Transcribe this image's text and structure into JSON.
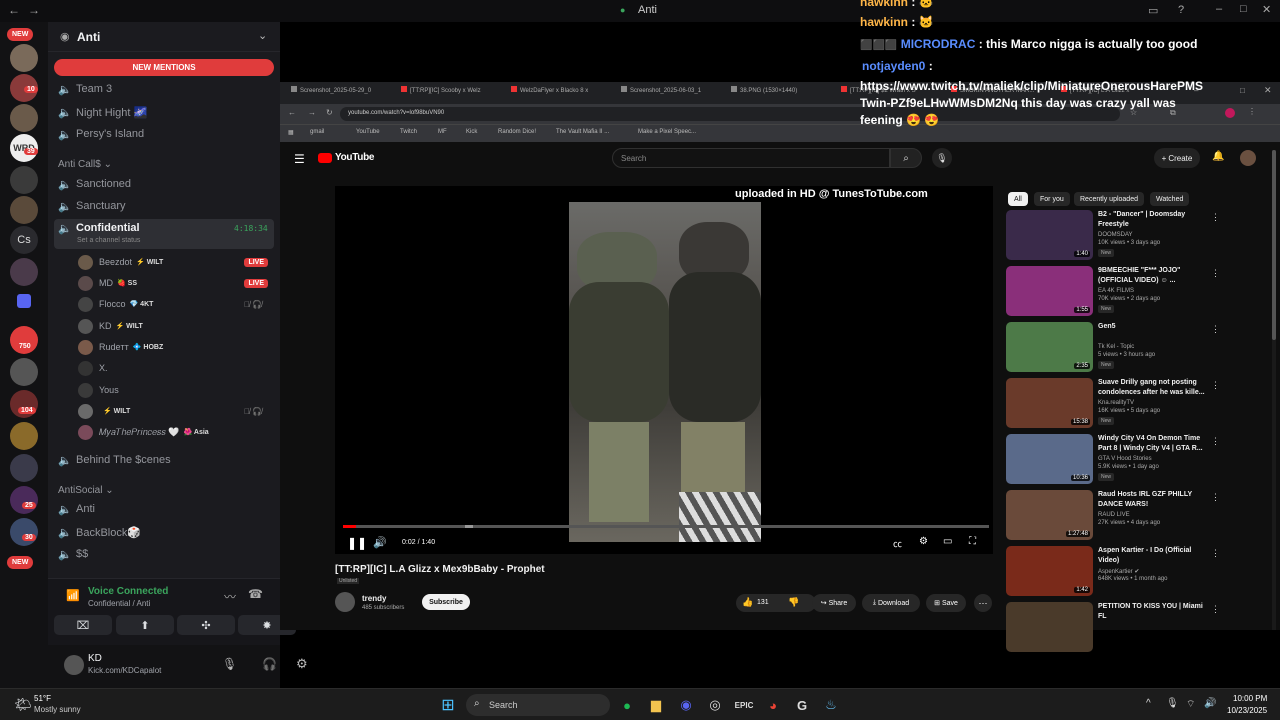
{
  "window": {
    "title": "Anti"
  },
  "rail": {
    "new_top": "NEW",
    "badges": [
      "10",
      "39",
      "750",
      "104",
      "25",
      "30"
    ],
    "new_bottom": "NEW",
    "cs_label": "Cs"
  },
  "server": {
    "name": "Anti",
    "mentions": "NEW MENTIONS"
  },
  "channels_top": [
    "Team 3",
    "Night Hight 🌌",
    "Persy's Island"
  ],
  "category_call": "Anti Call$",
  "channels_mid": [
    "Sanctioned",
    "Sanctuary"
  ],
  "active_channel": {
    "name": "Confidential",
    "timer": "4:18:34",
    "status": "Set a channel status"
  },
  "voice_users": [
    {
      "name": "Beezdot",
      "tag": "⚡ WILT",
      "live": "LIVE"
    },
    {
      "name": "MD",
      "tag": "🍓 SS",
      "live": "LIVE"
    },
    {
      "name": "Flocco",
      "tag": "💎 4KT",
      "live": ""
    },
    {
      "name": "KD",
      "tag": "⚡ WILT",
      "live": ""
    },
    {
      "name": "Rudeтт",
      "tag": "💠 HOBZ",
      "live": ""
    },
    {
      "name": "X.",
      "tag": "",
      "live": ""
    },
    {
      "name": "Yous",
      "tag": "",
      "live": ""
    },
    {
      "name": "",
      "tag": "⚡ WILT",
      "live": ""
    },
    {
      "name": "𝑀𝑦𝑎𝑇ℎ𝑒𝑃𝑟𝑖𝑛𝑐𝑒𝑠𝑠 🤍",
      "tag": "🌺 Asia",
      "live": ""
    }
  ],
  "channel_behind": "Behind The $cenes",
  "category_social": "AntiSocial",
  "channels_social": [
    "Anti",
    "BackBlock🎲",
    "$$"
  ],
  "voice": {
    "status": "Voice Connected",
    "location": "Confidential / Anti"
  },
  "account": {
    "name": "KD",
    "status": "Kick.com/KDCapalot"
  },
  "chat": [
    {
      "user": "hawkinn",
      "msg": ": 🐱"
    },
    {
      "user": "hawkinn",
      "msg": ": 🐱"
    },
    {
      "user": "MICRODRAC",
      "msg": ": this Marco nigga is actually too good"
    },
    {
      "user": "notjayden0",
      "msg": ":"
    },
    {
      "user": "",
      "msg": "https://www.twitch.tv/maliek/clip/MiniatureOnerousHarePMS"
    },
    {
      "user": "",
      "msg": "Twin-PZf9eLHwWMsDM2Nq this day was crazy yall was"
    },
    {
      "user": "",
      "msg": "feening 😍 😍"
    }
  ],
  "browser": {
    "tabs": [
      "Screenshot_2025-05-29_0",
      "[TT:RP][IC] Scooby x Welz",
      "WelzDaFlyer x Blacko 8 x",
      "Screenshot_2025-06-03_1",
      "38.PNG (1530×1440)",
      "[TT:RP][IC] $2 Wrath x S",
      "SMOKIN ANOTHER MAR...",
      "[TT:RP][IC] L.A Glizz x"
    ],
    "url": "youtube.com/watch?v=lof98buVN90",
    "bookmarks": [
      "gmail",
      "YouTube",
      "Twitch",
      "MF",
      "Kick",
      "Random Dice!",
      "The Vault Mafia II ...",
      "Make a Pixel Speec..."
    ]
  },
  "youtube": {
    "logo": "YouTube",
    "search_placeholder": "Search",
    "create": "Create",
    "watermark": "uploaded in HD @ TunesToTube.com",
    "time": "0:02 / 1:40",
    "progress_fraction": 0.02,
    "video_title": "[TT:RP][IC] L.A Glizz x Mex9bBaby - Prophet",
    "unlisted": "Unlisted",
    "channel": "trendy",
    "subscribers": "485 subscribers",
    "subscribe": "Subscribe",
    "likes": "131",
    "share": "Share",
    "download": "Download",
    "save": "Save",
    "chips": [
      "All",
      "For you",
      "Recently uploaded",
      "Watched"
    ],
    "recommendations": [
      {
        "title": "B2 - \"Dancer\" | Doomsday\nFreestyle",
        "channel": "DOOMSDAY",
        "meta": "10K views • 3 days ago",
        "new": "New",
        "duration": "1:40",
        "color": "#3a2a4a"
      },
      {
        "title": "9BMEECHIE \"F*** JOJO\"\n(OFFICIAL VIDEO) ☺ ...",
        "channel": "EA 4K FILMS",
        "meta": "70K views • 2 days ago",
        "new": "New",
        "duration": "1:55",
        "color": "#8a2f7a"
      },
      {
        "title": "Gen5",
        "channel": "Tk Kel - Topic",
        "meta": "5 views • 3 hours ago",
        "new": "New",
        "duration": "2:35",
        "color": "#4d7a48"
      },
      {
        "title": "Suave Drilly gang not posting\ncondolences after he was kille...",
        "channel": "Kna.realityTV",
        "meta": "16K views • 5 days ago",
        "new": "New",
        "duration": "15:38",
        "color": "#6a3a2a"
      },
      {
        "title": "Windy City V4 On Demon Time\nPart 8 | Windy City V4 | GTA R...",
        "channel": "GTA V Hood Stories",
        "meta": "5.9K views • 1 day ago",
        "new": "New",
        "duration": "10:36",
        "color": "#5a6a8a"
      },
      {
        "title": "Raud Hosts IRL GZF PHILLY\nDANCE WARS!",
        "channel": "RAUD LIVE",
        "meta": "27K views • 4 days ago",
        "new": "",
        "duration": "1:27:48",
        "color": "#6a4a3a"
      },
      {
        "title": "Aspen Kartier - I Do (Official\nVideo)",
        "channel": "AspenKartier ✔",
        "meta": "648K views • 1 month ago",
        "new": "",
        "duration": "1:42",
        "color": "#7a2a1a"
      },
      {
        "title": "PETITION TO KISS YOU | Miami\nFL",
        "channel": "",
        "meta": "",
        "new": "",
        "duration": "",
        "color": "#4a3a2a"
      }
    ]
  },
  "taskbar": {
    "weather_temp": "51°F",
    "weather_desc": "Mostly sunny",
    "search": "Search",
    "time": "10:00 PM",
    "date": "10/23/2025"
  }
}
